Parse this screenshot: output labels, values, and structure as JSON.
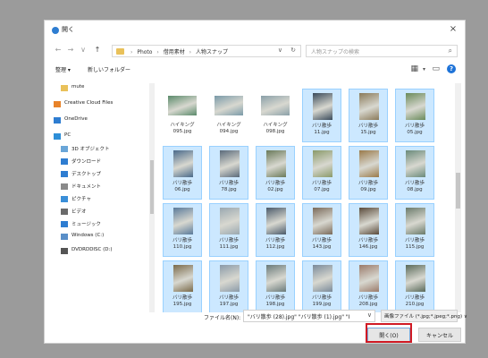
{
  "window": {
    "title": "開く",
    "close_glyph": "×"
  },
  "navbar": {
    "back": "←",
    "forward": "→",
    "recent": "∨",
    "up": "↑",
    "breadcrumbs": [
      "Photo",
      "借用素材",
      "人物スナップ"
    ],
    "dropdown": "∨",
    "refresh": "↻",
    "search_placeholder": "人物スナップの検索"
  },
  "toolbar": {
    "organize": "整理 ▾",
    "new_folder": "新しいフォルダー",
    "view_icon": "grid-view-icon",
    "pane_icon": "preview-pane-icon",
    "help": "?"
  },
  "nav_pane": {
    "items": [
      {
        "label": "mute",
        "icon": "folder-icon",
        "color": "#e9c15a"
      },
      {
        "label": "Creative Cloud Files",
        "icon": "creative-cloud-icon",
        "color": "#e8832a"
      },
      {
        "label": "OneDrive",
        "icon": "onedrive-icon",
        "color": "#2e7dd1"
      },
      {
        "label": "PC",
        "icon": "pc-icon",
        "color": "#2e8fd8"
      },
      {
        "label": "3D オブジェクト",
        "icon": "3d-objects-icon",
        "color": "#6aa6d8"
      },
      {
        "label": "ダウンロード",
        "icon": "download-icon",
        "color": "#2e7dd1"
      },
      {
        "label": "デスクトップ",
        "icon": "desktop-icon",
        "color": "#2e7dd1"
      },
      {
        "label": "ドキュメント",
        "icon": "documents-icon",
        "color": "#8a8a8a"
      },
      {
        "label": "ピクチャ",
        "icon": "pictures-icon",
        "color": "#3a8fd8"
      },
      {
        "label": "ビデオ",
        "icon": "videos-icon",
        "color": "#6a6a6a"
      },
      {
        "label": "ミュージック",
        "icon": "music-icon",
        "color": "#2e7dd1"
      },
      {
        "label": "Windows (C:)",
        "icon": "drive-icon",
        "color": "#5a8fc8"
      },
      {
        "label": "DVDRDDISC (D:)",
        "icon": "dvd-drive-icon",
        "color": "#555555"
      }
    ]
  },
  "files": [
    {
      "name": "ハイキング\n095.jpg",
      "selected": false,
      "landscape": true,
      "color": "#5a8a6a"
    },
    {
      "name": "ハイキング\n094.jpg",
      "selected": false,
      "landscape": true,
      "color": "#7a9aa8"
    },
    {
      "name": "ハイキング\n098.jpg",
      "selected": false,
      "landscape": true,
      "color": "#8aa0a8"
    },
    {
      "name": "バリ散歩\n11.jpg",
      "selected": true,
      "landscape": false,
      "color": "#3a4a5a"
    },
    {
      "name": "バリ散歩\n15.jpg",
      "selected": true,
      "landscape": false,
      "color": "#8a7a5a"
    },
    {
      "name": "バリ散歩\n05.jpg",
      "selected": true,
      "landscape": false,
      "color": "#6a8a5a"
    },
    {
      "name": "バリ散歩\n06.jpg",
      "selected": true,
      "landscape": false,
      "color": "#4a6a8a"
    },
    {
      "name": "バリ散歩\n78.jpg",
      "selected": true,
      "landscape": false,
      "color": "#5a6a7a"
    },
    {
      "name": "バリ散歩\n02.jpg",
      "selected": true,
      "landscape": false,
      "color": "#6a7a5a"
    },
    {
      "name": "バリ散歩\n07.jpg",
      "selected": true,
      "landscape": false,
      "color": "#8a9a6a"
    },
    {
      "name": "バリ散歩\n09.jpg",
      "selected": true,
      "landscape": false,
      "color": "#9a7a4a"
    },
    {
      "name": "バリ散歩\n08.jpg",
      "selected": true,
      "landscape": false,
      "color": "#6a8a7a"
    },
    {
      "name": "バリ散歩\n110.jpg",
      "selected": true,
      "landscape": false,
      "color": "#5a7a9a"
    },
    {
      "name": "バリ散歩\n111.jpg",
      "selected": true,
      "landscape": false,
      "color": "#9aa8b0"
    },
    {
      "name": "バリ散歩\n112.jpg",
      "selected": true,
      "landscape": false,
      "color": "#4a5a6a"
    },
    {
      "name": "バリ散歩\n143.jpg",
      "selected": true,
      "landscape": false,
      "color": "#7a6a5a"
    },
    {
      "name": "バリ散歩\n146.jpg",
      "selected": true,
      "landscape": false,
      "color": "#5a4a3a"
    },
    {
      "name": "バリ散歩\n115.jpg",
      "selected": true,
      "landscape": false,
      "color": "#6a7a6a"
    },
    {
      "name": "バリ散歩\n195.jpg",
      "selected": true,
      "landscape": false,
      "color": "#7a6a4a"
    },
    {
      "name": "バリ散歩\n197.jpg",
      "selected": true,
      "landscape": false,
      "color": "#8a9aa8"
    },
    {
      "name": "バリ散歩\n198.jpg",
      "selected": true,
      "landscape": false,
      "color": "#6a7a7a"
    },
    {
      "name": "バリ散歩\n199.jpg",
      "selected": true,
      "landscape": false,
      "color": "#7a8a9a"
    },
    {
      "name": "バリ散歩\n208.jpg",
      "selected": true,
      "landscape": false,
      "color": "#9a7a6a"
    },
    {
      "name": "バリ散歩\n210.jpg",
      "selected": true,
      "landscape": false,
      "color": "#5a6a5a"
    }
  ],
  "footer": {
    "filename_label": "ファイル名(N):",
    "filename_value": "\"バリ散歩 (28).jpg\" \"バリ散歩 (1).jpg\" \"I",
    "dropdown": "∨",
    "filetype": "画像ファイル (*.jpg;*.jpeg;*.png) ∨",
    "open": "開く(O)",
    "cancel": "キャンセル"
  }
}
